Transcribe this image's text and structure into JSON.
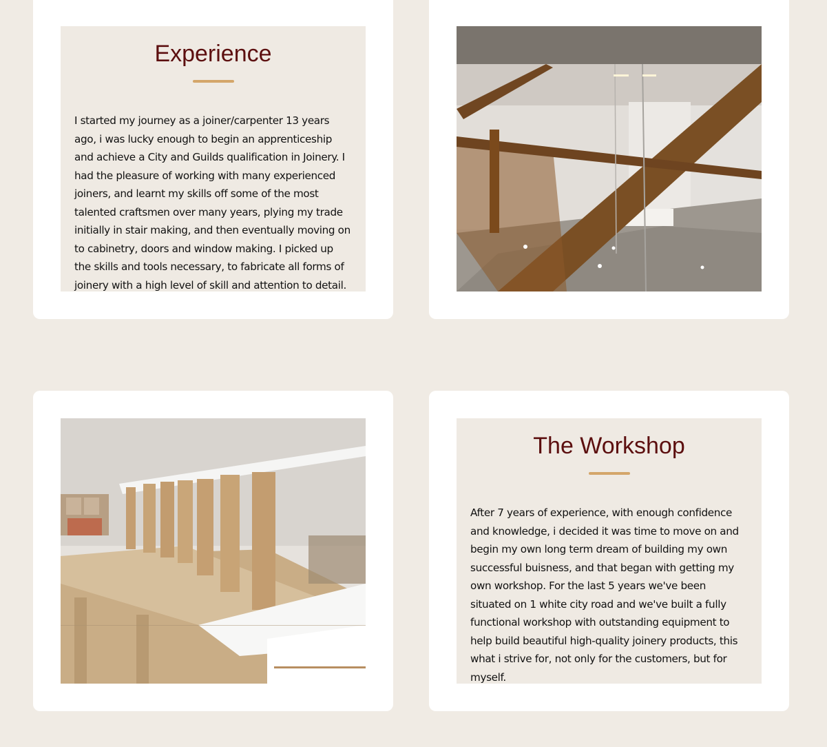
{
  "experience": {
    "title": "Experience",
    "body": "I started my journey as a joiner/carpenter 13 years ago, i was lucky enough to begin an apprenticeship and achieve a City and Guilds qualification in Joinery. I had the pleasure of working with many experienced joiners, and learnt my skills off some of the most talented craftsmen over many years, plying my trade initially in stair making, and then eventually moving on to cabinetry, doors and window making. I picked up the skills and tools necessary, to fabricate all forms of joinery with a high level of skill and attention to detail."
  },
  "workshop": {
    "title": "The Workshop",
    "body": "After 7 years of experience, with enough confidence and knowledge, i decided it was time to move on and begin my own long term dream of building my own successful buisness, and that began with getting my own workshop. For the last 5 years we've been situated on 1 white city road and we've built a fully functional workshop with outstanding equipment to help build beautiful high-quality joinery products, this what i strive for, not only for the customers, but for myself."
  },
  "colors": {
    "page_background": "#f0ebe4",
    "card_background": "#ffffff",
    "text_panel_background": "#efeae3",
    "heading": "#5c0f0f",
    "accent_rule": "#d4a66a"
  }
}
